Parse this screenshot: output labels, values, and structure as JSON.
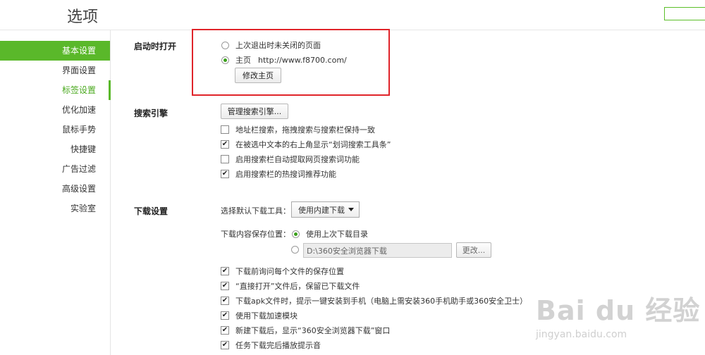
{
  "header": {
    "title": "选项"
  },
  "sidebar": {
    "items": [
      {
        "label": "基本设置"
      },
      {
        "label": "界面设置"
      },
      {
        "label": "标签设置"
      },
      {
        "label": "优化加速"
      },
      {
        "label": "鼠标手势"
      },
      {
        "label": "快捷键"
      },
      {
        "label": "广告过滤"
      },
      {
        "label": "高级设置"
      },
      {
        "label": "实验室"
      }
    ]
  },
  "startup": {
    "section_label": "启动时打开",
    "option_last": "上次退出时未关闭的页面",
    "option_home": "主页",
    "home_url": "http://www.f8700.com/",
    "change_home_button": "修改主页",
    "selected": "home"
  },
  "search": {
    "section_label": "搜索引擎",
    "manage_button": "管理搜索引擎...",
    "options": [
      {
        "label": "地址栏搜索，拖拽搜索与搜索栏保持一致",
        "checked": false
      },
      {
        "label": "在被选中文本的右上角显示“划词搜索工具条”",
        "checked": true
      },
      {
        "label": "启用搜索栏自动提取网页搜索词功能",
        "checked": false
      },
      {
        "label": "启用搜索栏的热搜词推荐功能",
        "checked": true
      }
    ]
  },
  "download": {
    "section_label": "下载设置",
    "tool_label": "选择默认下载工具：",
    "tool_selected": "使用内建下载",
    "location_label": "下载内容保存位置：",
    "location_last": "使用上次下载目录",
    "location_path": "D:\\360安全浏览器下载",
    "change_button": "更改...",
    "options": [
      {
        "label": "下载前询问每个文件的保存位置",
        "checked": true
      },
      {
        "label": "“直接打开”文件后，保留已下载文件",
        "checked": true
      },
      {
        "label": "下载apk文件时，提示一键安装到手机（电脑上需安装360手机助手或360安全卫士）",
        "checked": true
      },
      {
        "label": "使用下载加速模块",
        "checked": true
      },
      {
        "label": "新建下载后，显示“360安全浏览器下载”窗口",
        "checked": true
      },
      {
        "label": "任务下载完后播放提示音",
        "checked": true
      }
    ]
  },
  "watermark": {
    "brand": "Bai du 经验",
    "url": "jingyan.baidu.com"
  }
}
